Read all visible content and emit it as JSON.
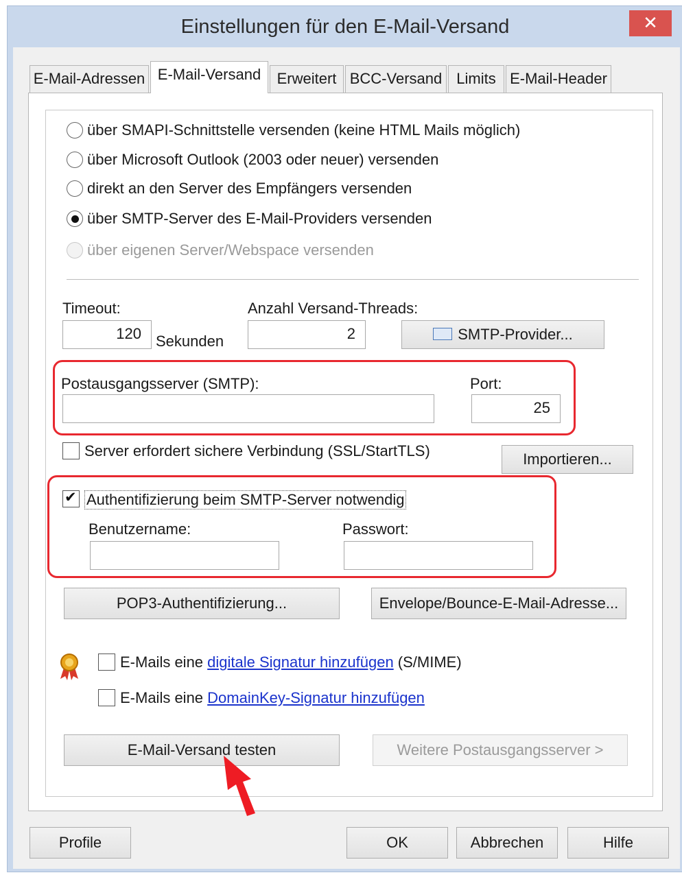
{
  "window": {
    "title": "Einstellungen für den E-Mail-Versand",
    "close_glyph": "✕"
  },
  "tabs": [
    {
      "label": "E-Mail-Adressen",
      "active": false
    },
    {
      "label": "E-Mail-Versand",
      "active": true
    },
    {
      "label": "Erweitert",
      "active": false
    },
    {
      "label": "BCC-Versand",
      "active": false
    },
    {
      "label": "Limits",
      "active": false
    },
    {
      "label": "E-Mail-Header",
      "active": false
    }
  ],
  "send_methods": [
    {
      "label": "über SMAPI-Schnittstelle versenden (keine HTML Mails möglich)",
      "checked": false,
      "disabled": false
    },
    {
      "label": "über Microsoft Outlook (2003 oder neuer) versenden",
      "checked": false,
      "disabled": false
    },
    {
      "label": "direkt an den Server des Empfängers versenden",
      "checked": false,
      "disabled": false
    },
    {
      "label": "über SMTP-Server des E-Mail-Providers versenden",
      "checked": true,
      "disabled": false
    },
    {
      "label": "über eigenen Server/Webspace versenden",
      "checked": false,
      "disabled": true
    }
  ],
  "timeout": {
    "label": "Timeout:",
    "value": "120",
    "unit": "Sekunden"
  },
  "threads": {
    "label": "Anzahl Versand-Threads:",
    "value": "2"
  },
  "smtp_provider_button": "SMTP-Provider...",
  "smtp_server": {
    "label": "Postausgangsserver (SMTP):",
    "value": ""
  },
  "port": {
    "label": "Port:",
    "value": "25"
  },
  "ssl": {
    "label": "Server erfordert sichere Verbindung (SSL/StartTLS)",
    "checked": false
  },
  "import_button": "Importieren...",
  "auth": {
    "label": "Authentifizierung beim SMTP-Server notwendig",
    "checked": true,
    "username_label": "Benutzername:",
    "username_value": "",
    "password_label": "Passwort:",
    "password_value": ""
  },
  "pop3_button": "POP3-Authentifizierung...",
  "envelope_button": "Envelope/Bounce-E-Mail-Adresse...",
  "smime": {
    "prefix": "E-Mails eine ",
    "link": "digitale Signatur hinzufügen",
    "suffix": " (S/MIME)",
    "checked": false
  },
  "dkim": {
    "prefix": "E-Mails eine ",
    "link": "DomainKey-Signatur hinzufügen",
    "checked": false
  },
  "test_button": "E-Mail-Versand testen",
  "more_servers_button": "Weitere Postausgangsserver >",
  "footer": {
    "profile": "Profile",
    "ok": "OK",
    "cancel": "Abbrechen",
    "help": "Hilfe"
  },
  "colors": {
    "highlight": "#e8282f",
    "link": "#1a33cc",
    "close": "#d9534f"
  }
}
